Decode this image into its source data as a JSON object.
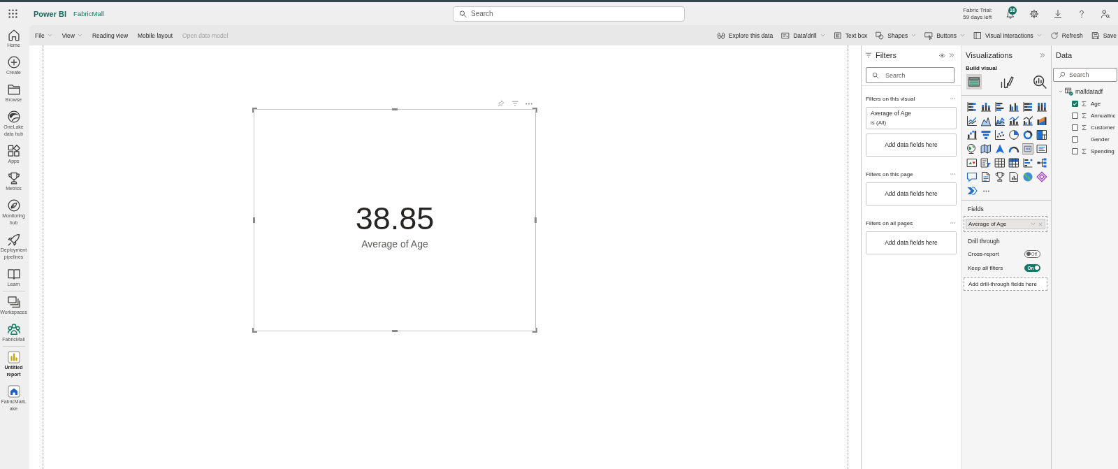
{
  "app_bar": {
    "product": "Power BI",
    "workspace": "FabricMall",
    "search": {
      "placeholder": "Search"
    },
    "trial": [
      "Fabric Trial:",
      "59 days left"
    ],
    "notifications": "16"
  },
  "nav": {
    "groups": [
      [
        {
          "kind": "home",
          "label": "Home",
          "selected": false
        },
        {
          "kind": "create",
          "label": "Create",
          "selected": false
        },
        {
          "kind": "browse",
          "label": "Browse",
          "selected": false
        },
        {
          "kind": "onelake",
          "label": "OneLake data hub",
          "selected": false
        },
        {
          "kind": "apps",
          "label": "Apps",
          "selected": false
        },
        {
          "kind": "metrics",
          "label": "Metrics",
          "selected": false
        },
        {
          "kind": "monitoring",
          "label": "Monitoring hub",
          "selected": false
        },
        {
          "kind": "deployment",
          "label": "Deployment pipelines",
          "selected": false
        },
        {
          "kind": "learn",
          "label": "Learn",
          "selected": false
        }
      ],
      [
        {
          "kind": "workspaces",
          "label": "Workspaces",
          "selected": false
        },
        {
          "kind": "workspace",
          "label": "FabricMall",
          "selected": false
        }
      ],
      [
        {
          "kind": "report",
          "label": "Untitled report",
          "selected": true
        },
        {
          "kind": "lakehouse",
          "label": "FabricMallLake",
          "selected": false
        }
      ]
    ]
  },
  "toolbar": {
    "left": [
      {
        "label": "File",
        "dropdown": true,
        "disabled": false
      },
      {
        "label": "View",
        "dropdown": true,
        "disabled": false
      },
      {
        "label": "Reading view",
        "dropdown": false,
        "disabled": false
      },
      {
        "label": "Mobile layout",
        "dropdown": false,
        "disabled": false
      },
      {
        "label": "Open data model",
        "dropdown": false,
        "disabled": true
      }
    ],
    "right": [
      {
        "kind": "explore",
        "label": "Explore this data",
        "dropdown": false
      },
      {
        "kind": "data-drill",
        "label": "Data/drill",
        "dropdown": true
      },
      {
        "kind": "text-box",
        "label": "Text box",
        "dropdown": false
      },
      {
        "kind": "shapes",
        "label": "Shapes",
        "dropdown": true
      },
      {
        "kind": "buttons",
        "label": "Buttons",
        "dropdown": true
      },
      {
        "kind": "visual-interactions",
        "label": "Visual interactions",
        "dropdown": true
      },
      {
        "kind": "refresh",
        "label": "Refresh",
        "dropdown": false
      },
      {
        "kind": "save",
        "label": "Save",
        "dropdown": false
      }
    ]
  },
  "visual": {
    "value": "38.85",
    "label": "Average of Age",
    "selected": true
  },
  "filters": {
    "title": "Filters",
    "search": {
      "placeholder": "Search"
    },
    "sections": [
      {
        "title": "Filters on this visual",
        "cards": [
          {
            "kind": "filter",
            "field": "Average of Age",
            "condition": "is (All)"
          },
          {
            "kind": "drop",
            "label": "Add data fields here"
          }
        ]
      },
      {
        "title": "Filters on this page",
        "cards": [
          {
            "kind": "drop",
            "label": "Add data fields here"
          }
        ]
      },
      {
        "title": "Filters on all pages",
        "cards": [
          {
            "kind": "drop",
            "label": "Add data fields here"
          }
        ]
      }
    ]
  },
  "visualizations": {
    "title": "Visualizations",
    "subtitle": "Build visual",
    "build_tabs": [
      {
        "kind": "fields",
        "selected": true
      },
      {
        "kind": "format",
        "selected": false
      },
      {
        "kind": "analytics",
        "selected": false
      }
    ],
    "types": [
      {
        "kind": "stacked-bar-chart",
        "selected": false
      },
      {
        "kind": "stacked-column-chart",
        "selected": false
      },
      {
        "kind": "clustered-bar-chart",
        "selected": false
      },
      {
        "kind": "clustered-column-chart",
        "selected": false
      },
      {
        "kind": "full-stacked-bar-chart",
        "selected": false
      },
      {
        "kind": "full-stacked-column-chart",
        "selected": false
      },
      {
        "kind": "line-chart",
        "selected": false
      },
      {
        "kind": "area-chart",
        "selected": false
      },
      {
        "kind": "stacked-area-chart",
        "selected": false
      },
      {
        "kind": "line-column-chart",
        "selected": false
      },
      {
        "kind": "line-clustered-column-chart",
        "selected": false
      },
      {
        "kind": "ribbon-chart",
        "selected": false
      },
      {
        "kind": "waterfall-chart",
        "selected": false
      },
      {
        "kind": "funnel-chart",
        "selected": false
      },
      {
        "kind": "scatter-chart",
        "selected": false
      },
      {
        "kind": "pie-chart",
        "selected": false
      },
      {
        "kind": "donut-chart",
        "selected": false
      },
      {
        "kind": "treemap",
        "selected": false
      },
      {
        "kind": "globe-map",
        "selected": false
      },
      {
        "kind": "filled-map",
        "selected": false
      },
      {
        "kind": "azure-map",
        "selected": false
      },
      {
        "kind": "gauge",
        "selected": false
      },
      {
        "kind": "card",
        "selected": true
      },
      {
        "kind": "multi-row-card",
        "selected": false
      },
      {
        "kind": "kpi",
        "selected": false
      },
      {
        "kind": "slicer",
        "selected": false
      },
      {
        "kind": "table",
        "selected": false
      },
      {
        "kind": "matrix",
        "selected": false
      },
      {
        "kind": "key-influencers",
        "selected": false
      },
      {
        "kind": "decomposition-tree",
        "selected": false
      },
      {
        "kind": "qna",
        "selected": false
      },
      {
        "kind": "narrative",
        "selected": false
      },
      {
        "kind": "goals",
        "selected": false
      },
      {
        "kind": "paginated-report",
        "selected": false
      },
      {
        "kind": "arcgis-map",
        "selected": false
      },
      {
        "kind": "power-apps",
        "selected": false
      },
      {
        "kind": "power-automate",
        "selected": false
      }
    ],
    "fields_title": "Fields",
    "field_wells": [
      {
        "label": "Average of Age"
      }
    ],
    "drill_title": "Drill through",
    "toggles": [
      {
        "label": "Cross-report",
        "on": false,
        "state_label": "Off"
      },
      {
        "label": "Keep all filters",
        "on": true,
        "state_label": "On"
      }
    ],
    "drill_drop": "Add drill-through fields here"
  },
  "data": {
    "title": "Data",
    "search": {
      "placeholder": "Search"
    },
    "tables": [
      {
        "name": "malldatadf",
        "expanded": true,
        "fields": [
          {
            "name": "Age",
            "kind": "measure",
            "checked": true
          },
          {
            "name": "AnnualInc",
            "kind": "measure",
            "checked": false
          },
          {
            "name": "Customer",
            "kind": "measure",
            "checked": false
          },
          {
            "name": "Gender",
            "kind": "text",
            "checked": false
          },
          {
            "name": "Spending",
            "kind": "measure",
            "checked": false
          }
        ]
      }
    ]
  }
}
